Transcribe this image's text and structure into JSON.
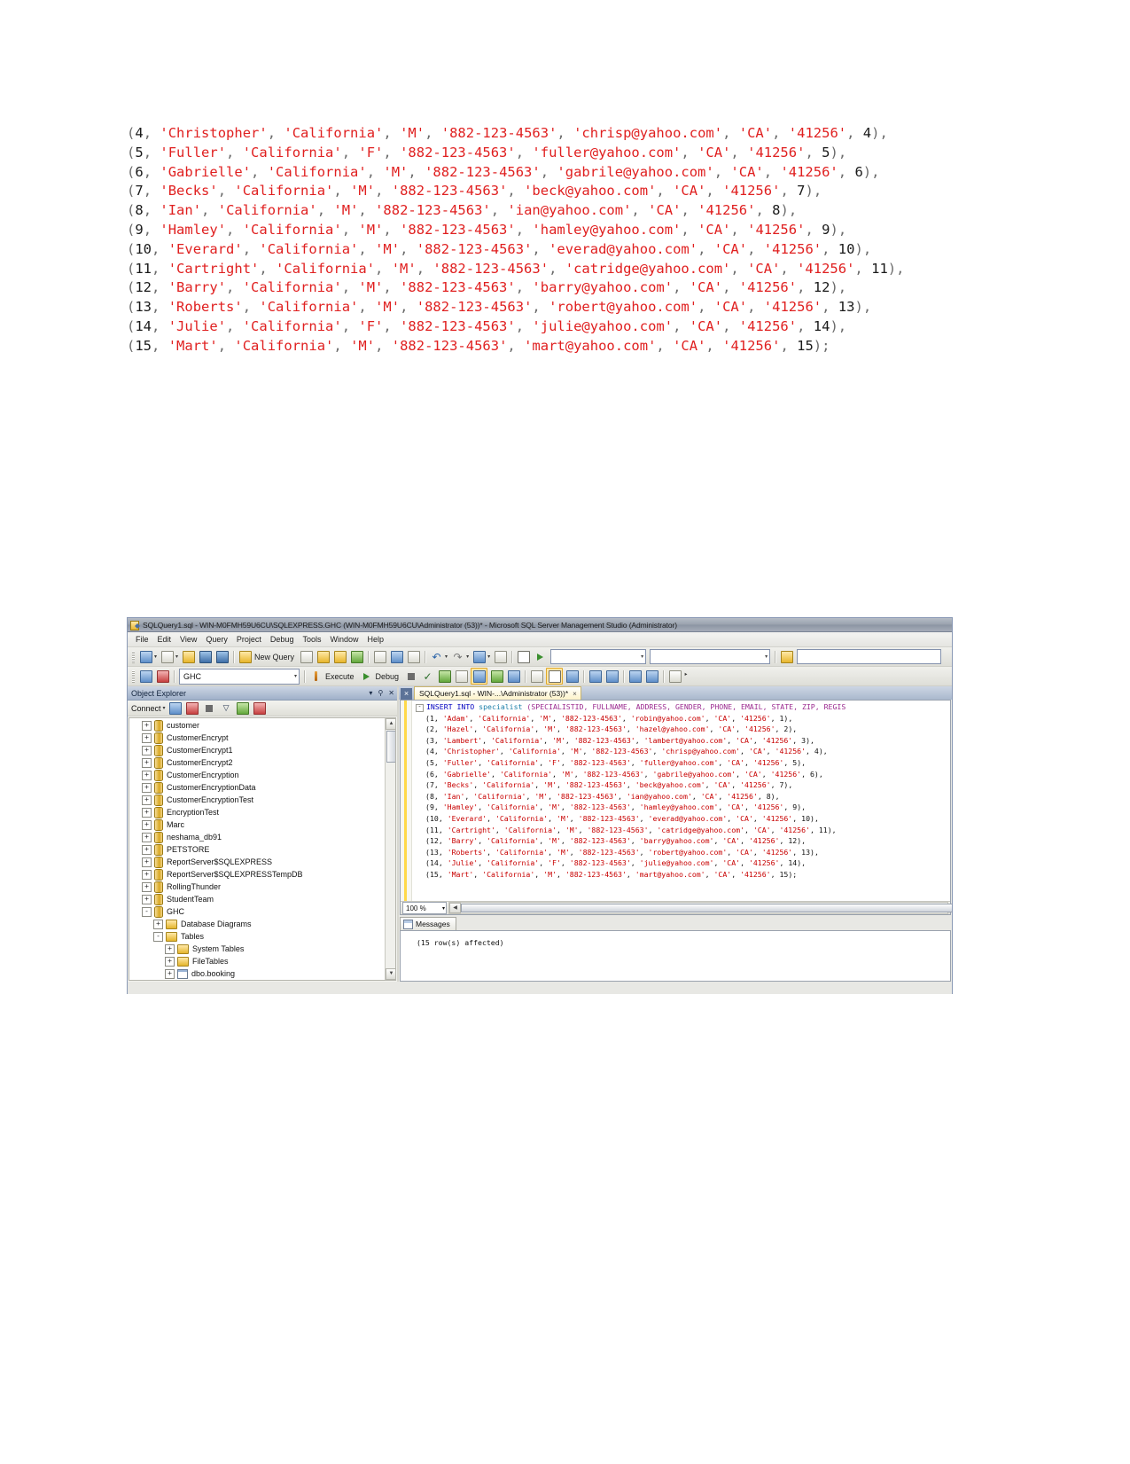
{
  "code_listing": {
    "lines": [
      "(4, 'Christopher', 'California', 'M', '882-123-4563', 'chrisp@yahoo.com', 'CA', '41256', 4),",
      "(5, 'Fuller', 'California', 'F', '882-123-4563', 'fuller@yahoo.com', 'CA', '41256', 5),",
      "(6, 'Gabrielle', 'California', 'M', '882-123-4563', 'gabrile@yahoo.com', 'CA', '41256', 6),",
      "(7, 'Becks', 'California', 'M', '882-123-4563', 'beck@yahoo.com', 'CA', '41256', 7),",
      "(8, 'Ian', 'California', 'M', '882-123-4563', 'ian@yahoo.com', 'CA', '41256', 8),",
      "(9, 'Hamley', 'California', 'M', '882-123-4563', 'hamley@yahoo.com', 'CA', '41256', 9),",
      "(10, 'Everard', 'California', 'M', '882-123-4563', 'everad@yahoo.com', 'CA', '41256', 10),",
      "(11, 'Cartright', 'California', 'M', '882-123-4563', 'catridge@yahoo.com', 'CA', '41256', 11),",
      "(12, 'Barry', 'California', 'M', '882-123-4563', 'barry@yahoo.com', 'CA', '41256', 12),",
      "(13, 'Roberts', 'California', 'M', '882-123-4563', 'robert@yahoo.com', 'CA', '41256', 13),",
      "(14, 'Julie', 'California', 'F', '882-123-4563', 'julie@yahoo.com', 'CA', '41256', 14),",
      "(15, 'Mart', 'California', 'M', '882-123-4563', 'mart@yahoo.com', 'CA', '41256', 15);"
    ],
    "colors": {
      "string": "#e02020",
      "punctuation": "#6b6b6b",
      "number": "#1a1a1a"
    }
  },
  "window": {
    "title": "SQLQuery1.sql - WIN-M0FMH59U6CU\\SQLEXPRESS.GHC (WIN-M0FMH59U6CU\\Administrator (53))* - Microsoft SQL Server Management Studio (Administrator)",
    "app_icon": "ssms-app-icon"
  },
  "menubar": {
    "items": [
      {
        "label": "File"
      },
      {
        "label": "Edit"
      },
      {
        "label": "View"
      },
      {
        "label": "Query"
      },
      {
        "label": "Project"
      },
      {
        "label": "Debug"
      },
      {
        "label": "Tools"
      },
      {
        "label": "Window"
      },
      {
        "label": "Help"
      }
    ]
  },
  "toolbar_main": {
    "new_query_label": "New Query",
    "icons": [
      "new-item-icon",
      "new-project-icon",
      "open-file-icon",
      "save-icon",
      "save-all-icon",
      "new-query-icon",
      "new-database-engine-query-icon",
      "new-analysis-services-mdx-query-icon",
      "new-analysis-services-dmx-query-icon",
      "new-sql-server-compact-query-icon",
      "cut-icon",
      "copy-icon",
      "paste-icon",
      "undo-icon",
      "redo-icon",
      "navigate-backward-icon",
      "navigate-forward-icon"
    ]
  },
  "toolbar_query": {
    "database_value": "GHC",
    "execute_label": "Execute",
    "debug_label": "Debug",
    "icons": [
      "connect-icon",
      "disconnect-icon",
      "execute-icon",
      "debug-icon",
      "stop-icon",
      "parse-icon",
      "display-estimated-execution-plan-icon",
      "query-options-icon",
      "results-to-text-icon",
      "results-to-grid-icon",
      "results-to-file-icon",
      "include-actual-execution-plan-icon",
      "include-client-statistics-icon",
      "comment-icon",
      "uncomment-icon",
      "decrease-indent-icon",
      "increase-indent-icon",
      "specify-values-for-template-parameters-icon"
    ]
  },
  "object_explorer": {
    "title": "Object Explorer",
    "connect_label": "Connect",
    "toolbar_icons": [
      "connect-object-explorer-icon",
      "disconnect-object-explorer-icon",
      "stop-icon",
      "filter-icon",
      "refresh-icon",
      "remove-icon"
    ],
    "header_icons": [
      "chevron-down-icon",
      "pin-icon",
      "close-icon"
    ],
    "tree": [
      {
        "label": "customer",
        "indent": 0,
        "state": "+",
        "icon": "database-icon"
      },
      {
        "label": "CustomerEncrypt",
        "indent": 0,
        "state": "+",
        "icon": "database-icon"
      },
      {
        "label": "CustomerEncrypt1",
        "indent": 0,
        "state": "+",
        "icon": "database-icon"
      },
      {
        "label": "CustomerEncrypt2",
        "indent": 0,
        "state": "+",
        "icon": "database-icon"
      },
      {
        "label": "CustomerEncryption",
        "indent": 0,
        "state": "+",
        "icon": "database-icon"
      },
      {
        "label": "CustomerEncryptionData",
        "indent": 0,
        "state": "+",
        "icon": "database-icon"
      },
      {
        "label": "CustomerEncryptionTest",
        "indent": 0,
        "state": "+",
        "icon": "database-icon"
      },
      {
        "label": "EncryptionTest",
        "indent": 0,
        "state": "+",
        "icon": "database-icon"
      },
      {
        "label": "Marc",
        "indent": 0,
        "state": "+",
        "icon": "database-icon"
      },
      {
        "label": "neshama_db91",
        "indent": 0,
        "state": "+",
        "icon": "database-icon"
      },
      {
        "label": "PETSTORE",
        "indent": 0,
        "state": "+",
        "icon": "database-icon"
      },
      {
        "label": "ReportServer$SQLEXPRESS",
        "indent": 0,
        "state": "+",
        "icon": "database-icon"
      },
      {
        "label": "ReportServer$SQLEXPRESSTempDB",
        "indent": 0,
        "state": "+",
        "icon": "database-icon"
      },
      {
        "label": "RollingThunder",
        "indent": 0,
        "state": "+",
        "icon": "database-icon"
      },
      {
        "label": "StudentTeam",
        "indent": 0,
        "state": "+",
        "icon": "database-icon"
      },
      {
        "label": "GHC",
        "indent": 0,
        "state": "-",
        "icon": "database-icon"
      },
      {
        "label": "Database Diagrams",
        "indent": 1,
        "state": "+",
        "icon": "folder-icon"
      },
      {
        "label": "Tables",
        "indent": 1,
        "state": "-",
        "icon": "folder-icon"
      },
      {
        "label": "System Tables",
        "indent": 2,
        "state": "+",
        "icon": "folder-icon"
      },
      {
        "label": "FileTables",
        "indent": 2,
        "state": "+",
        "icon": "folder-icon"
      },
      {
        "label": "dbo.booking",
        "indent": 2,
        "state": "+",
        "icon": "table-icon"
      }
    ]
  },
  "editor": {
    "tab_label": "SQLQuery1.sql - WIN-...\\Administrator (53))*",
    "tab_close": "×",
    "strip_close": "×",
    "header_line": "INSERT INTO specialist (SPECIALISTID, FULLNAME, ADDRESS, GENDER, PHONE, EMAIL, STATE, ZIP, REGIS",
    "header_tokens": {
      "keyword": "INSERT INTO",
      "table": "specialist",
      "columns": "(SPECIALISTID, FULLNAME, ADDRESS, GENDER, PHONE, EMAIL, STATE, ZIP, REGIS"
    },
    "rows": [
      "(1, 'Adam', 'California', 'M', '882-123-4563', 'robin@yahoo.com', 'CA', '41256', 1),",
      "(2, 'Hazel', 'California', 'M', '882-123-4563', 'hazel@yahoo.com', 'CA', '41256', 2),",
      "(3, 'Lambert', 'California', 'M', '882-123-4563', 'lambert@yahoo.com', 'CA', '41256', 3),",
      "(4, 'Christopher', 'California', 'M', '882-123-4563', 'chrisp@yahoo.com', 'CA', '41256', 4),",
      "(5, 'Fuller', 'California', 'F', '882-123-4563', 'fuller@yahoo.com', 'CA', '41256', 5),",
      "(6, 'Gabrielle', 'California', 'M', '882-123-4563', 'gabrile@yahoo.com', 'CA', '41256', 6),",
      "(7, 'Becks', 'California', 'M', '882-123-4563', 'beck@yahoo.com', 'CA', '41256', 7),",
      "(8, 'Ian', 'California', 'M', '882-123-4563', 'ian@yahoo.com', 'CA', '41256', 8),",
      "(9, 'Hamley', 'California', 'M', '882-123-4563', 'hamley@yahoo.com', 'CA', '41256', 9),",
      "(10, 'Everard', 'California', 'M', '882-123-4563', 'everad@yahoo.com', 'CA', '41256', 10),",
      "(11, 'Cartright', 'California', 'M', '882-123-4563', 'catridge@yahoo.com', 'CA', '41256', 11),",
      "(12, 'Barry', 'California', 'M', '882-123-4563', 'barry@yahoo.com', 'CA', '41256', 12),",
      "(13, 'Roberts', 'California', 'M', '882-123-4563', 'robert@yahoo.com', 'CA', '41256', 13),",
      "(14, 'Julie', 'California', 'F', '882-123-4563', 'julie@yahoo.com', 'CA', '41256', 14),",
      "(15, 'Mart', 'California', 'M', '882-123-4563', 'mart@yahoo.com', 'CA', '41256', 15);"
    ],
    "zoom": "100 %",
    "zoom_caret": "▾"
  },
  "messages": {
    "tab_label": "Messages",
    "text": "(15 row(s) affected)"
  }
}
